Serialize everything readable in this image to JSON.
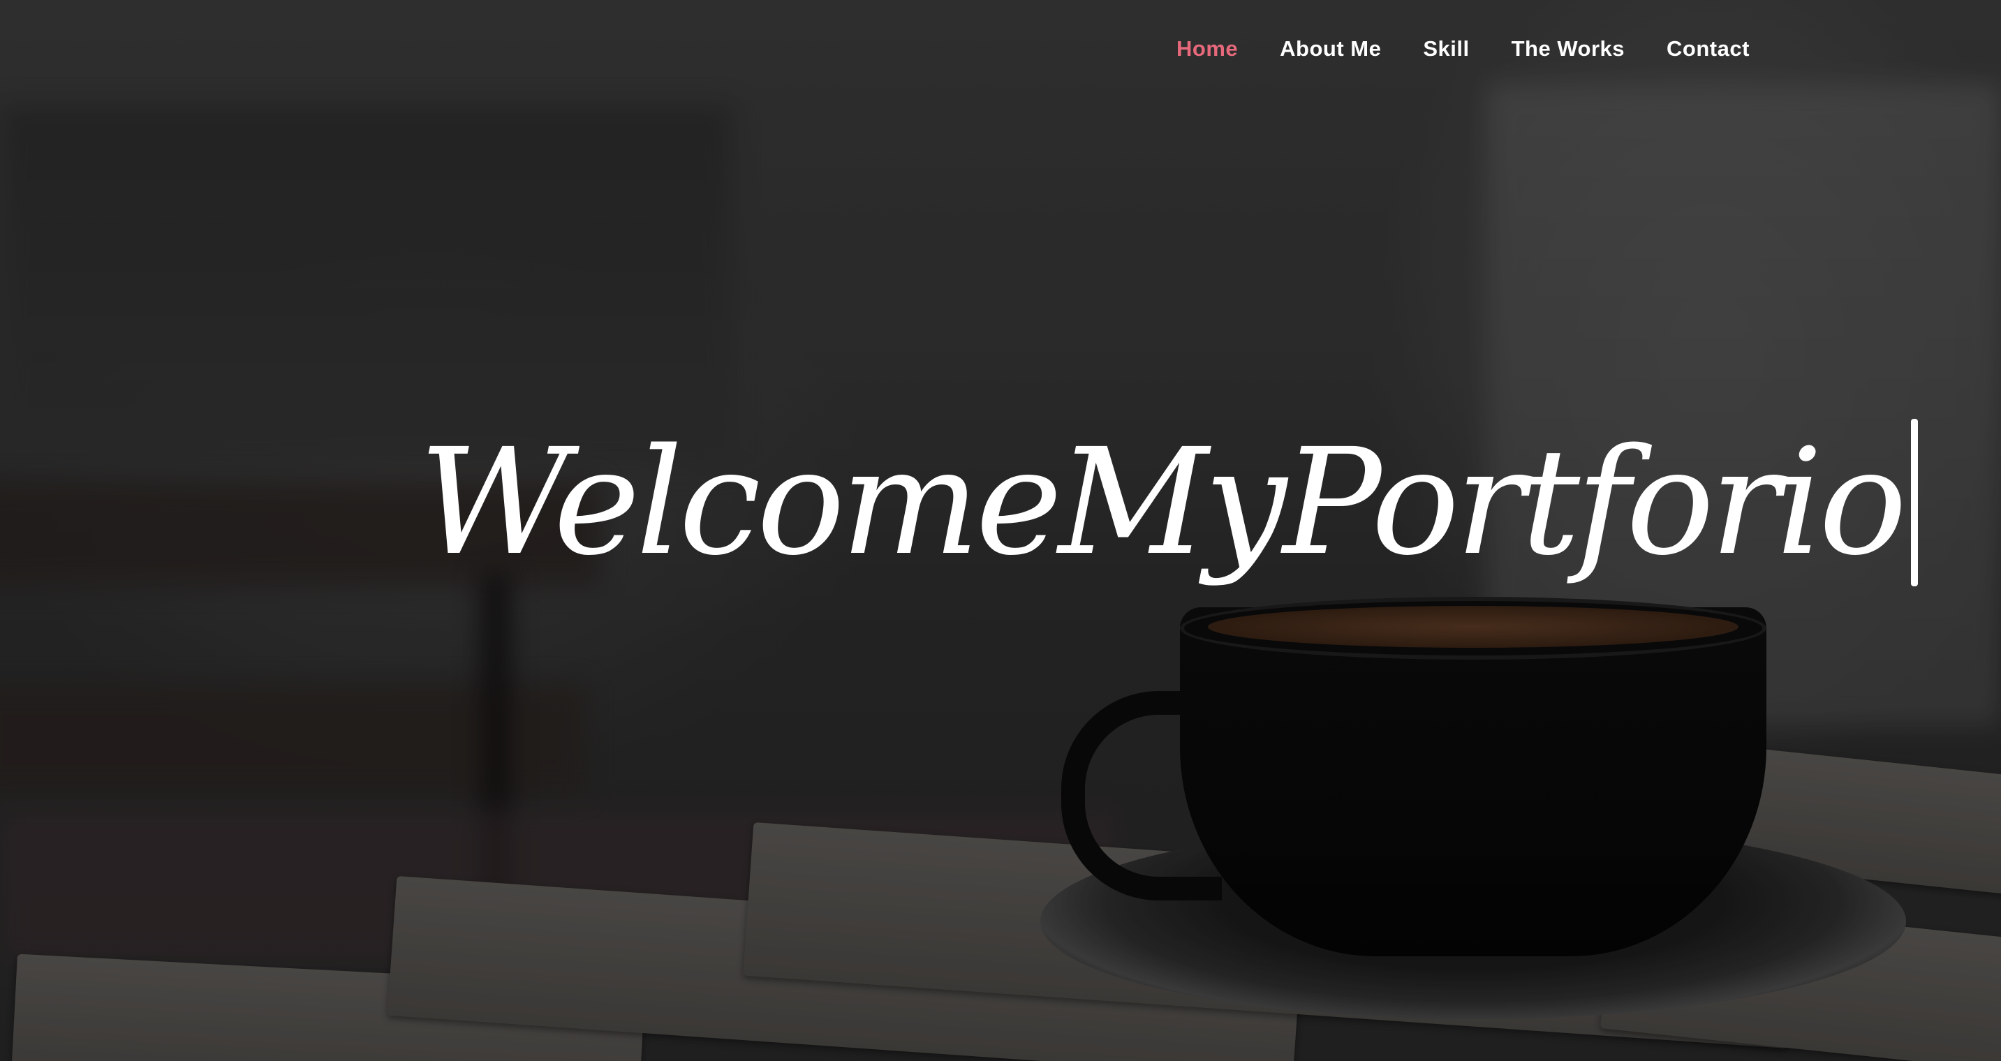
{
  "nav": {
    "items": [
      {
        "label": "Home",
        "active": true
      },
      {
        "label": "About Me",
        "active": false
      },
      {
        "label": "Skill",
        "active": false
      },
      {
        "label": "The Works",
        "active": false
      },
      {
        "label": "Contact",
        "active": false
      }
    ]
  },
  "hero": {
    "headline": "WelcomeMyPortforio"
  },
  "colors": {
    "active_link": "#e8697c",
    "text": "#ffffff"
  }
}
